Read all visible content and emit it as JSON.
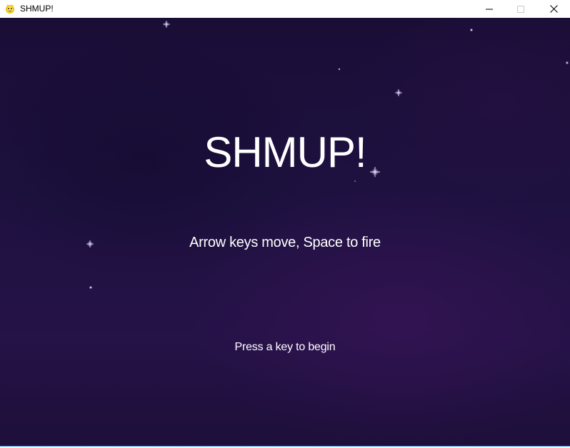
{
  "window": {
    "title": "SHMUP!",
    "icon": "pygame-snake-icon",
    "controls": {
      "minimize_icon": "minimize-icon",
      "maximize_icon": "maximize-icon",
      "close_icon": "close-icon"
    }
  },
  "game": {
    "title": "SHMUP!",
    "instructions": "Arrow keys move, Space to fire",
    "prompt": "Press a key to begin",
    "background_color": "#1e1140",
    "text_color": "#ffffff"
  }
}
